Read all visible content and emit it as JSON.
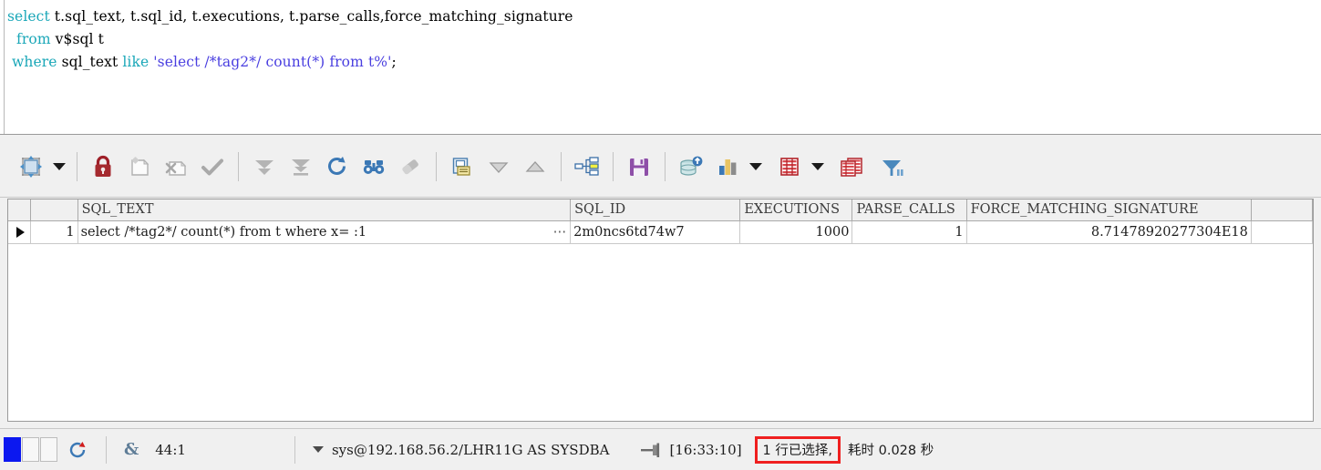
{
  "editor": {
    "line1": {
      "seg1": "select",
      "seg2": " t.sql_text, t.sql_id, t.executions, t.parse_calls,force_matching_signature"
    },
    "line2": {
      "seg1": "  from",
      "seg2": " v$sql t"
    },
    "line3": {
      "seg1": " where",
      "seg2": " sql_text ",
      "seg3": "like",
      "seg4": " ",
      "seg5": "'select /*tag2*/ count(*) from t%'",
      "seg6": ";"
    },
    "full_text": "select t.sql_text, t.sql_id, t.executions, t.parse_calls,force_matching_signature\n  from v$sql t\n where sql_text like 'select /*tag2*/ count(*) from t%';"
  },
  "toolbar": {
    "items": [
      {
        "name": "grid-layout-icon",
        "label": "Grid layout"
      },
      {
        "name": "chevron-down-icon",
        "label": "Layout options"
      },
      {
        "name": "lock-icon",
        "label": "Lock record"
      },
      {
        "name": "new-record-icon",
        "label": "Insert record"
      },
      {
        "name": "delete-record-icon",
        "label": "Delete record"
      },
      {
        "name": "commit-check-icon",
        "label": "Post changes"
      },
      {
        "name": "fetch-next-page-icon",
        "label": "Fetch next page"
      },
      {
        "name": "fetch-last-page-icon",
        "label": "Fetch last page"
      },
      {
        "name": "refresh-icon",
        "label": "Refresh"
      },
      {
        "name": "binoculars-search-icon",
        "label": "Find"
      },
      {
        "name": "eraser-icon",
        "label": "Clear"
      },
      {
        "name": "single-record-view-icon",
        "label": "Single record view"
      },
      {
        "name": "sort-descending-icon",
        "label": "Sort descending"
      },
      {
        "name": "sort-ascending-icon",
        "label": "Sort ascending"
      },
      {
        "name": "sitemap-icon",
        "label": "Explain plan"
      },
      {
        "name": "save-floppy-icon",
        "label": "Export results"
      },
      {
        "name": "database-upload-icon",
        "label": "Load in database"
      },
      {
        "name": "bar-chart-icon",
        "label": "Chart"
      },
      {
        "name": "chevron-down-icon-2",
        "label": "Chart options"
      },
      {
        "name": "table-grid-icon",
        "label": "Table view"
      },
      {
        "name": "chevron-down-icon-3",
        "label": "Table view options"
      },
      {
        "name": "copy-table-icon",
        "label": "Duplicate grid"
      },
      {
        "name": "copy-table-icon-2",
        "label": "Copy grid"
      },
      {
        "name": "filter-funnel-icon",
        "label": "Filter"
      }
    ]
  },
  "grid": {
    "columns": [
      {
        "key": "marker",
        "label": ""
      },
      {
        "key": "rownum",
        "label": ""
      },
      {
        "key": "sql_text",
        "label": "SQL_TEXT"
      },
      {
        "key": "sql_id",
        "label": "SQL_ID"
      },
      {
        "key": "executions",
        "label": "EXECUTIONS"
      },
      {
        "key": "parse_calls",
        "label": "PARSE_CALLS"
      },
      {
        "key": "force_matching_signature",
        "label": "FORCE_MATCHING_SIGNATURE"
      },
      {
        "key": "tail",
        "label": ""
      }
    ],
    "rows": [
      {
        "rownum": "1",
        "sql_text": "select /*tag2*/ count(*) from t where x= :1",
        "sql_text_overflow": "⋯",
        "sql_id": "2m0ncs6td74w7",
        "executions": "1000",
        "parse_calls": "1",
        "force_matching_signature": "8.71478920277304E18"
      }
    ],
    "empty_row_count": 8
  },
  "status_bar": {
    "modified_indicator": "",
    "cursor_position": "44:1",
    "ampersand_label": "&",
    "connection": "sys@192.168.56.2/LHR11G AS SYSDBA",
    "timestamp": "[16:33:10]",
    "rows_selected": "1 行已选择,",
    "elapsed": "耗时 0.028 秒"
  },
  "colors": {
    "keyword": "#1aa7b8",
    "string": "#4a3fe0",
    "highlight_border": "#ef1f1f",
    "active_box": "#0b18f0",
    "panel_bg": "#f0f0f0"
  }
}
